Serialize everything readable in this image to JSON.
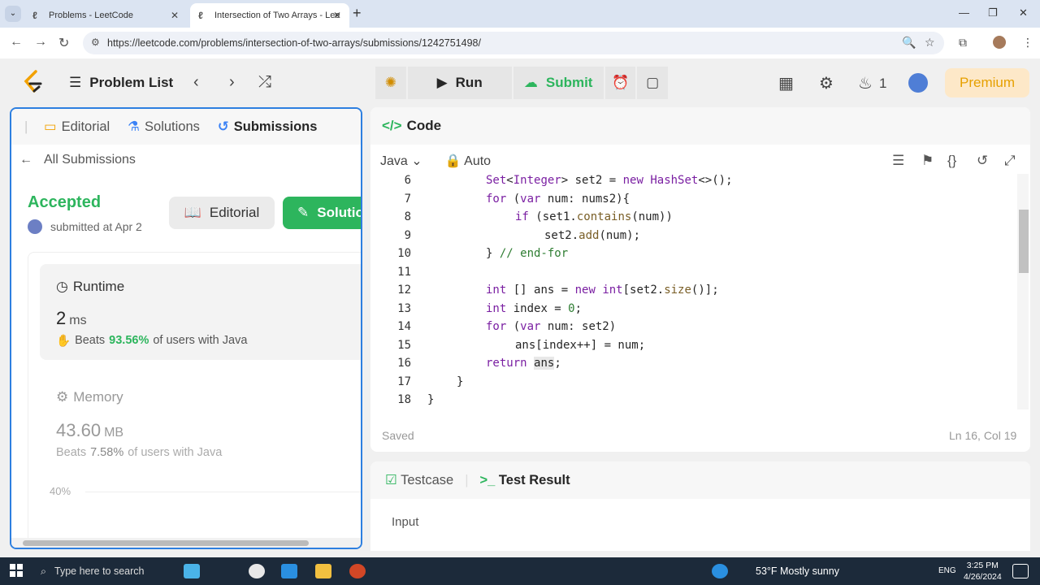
{
  "browser": {
    "tabs": [
      {
        "title": "Problems - LeetCode",
        "close": "✕"
      },
      {
        "title": "Intersection of Two Arrays - Lee",
        "close": "✕"
      }
    ],
    "url": "https://leetcode.com/problems/intersection-of-two-arrays/submissions/1242751498/"
  },
  "header": {
    "problem_list": "Problem List",
    "run": "Run",
    "submit": "Submit",
    "streak": "1",
    "premium": "Premium"
  },
  "left": {
    "tabs": [
      "Editorial",
      "Solutions",
      "Submissions"
    ],
    "all_submissions": "All Submissions",
    "status": "Accepted",
    "submitted": "submitted at Apr 2",
    "editorial_btn": "Editorial",
    "solution_btn": "Solution",
    "runtime": {
      "title": "Runtime",
      "value": "2",
      "unit": "ms",
      "beats_prefix": "Beats",
      "beats_pct": "93.56%",
      "beats_suffix": "of users with Java"
    },
    "memory": {
      "title": "Memory",
      "value": "43.60",
      "unit": "MB",
      "beats_prefix": "Beats",
      "beats_pct": "7.58%",
      "beats_suffix": "of users with Java"
    },
    "chart_tick": "40%"
  },
  "code": {
    "title": "Code",
    "language": "Java",
    "mode": "Auto",
    "saved": "Saved",
    "cursor": "Ln 16, Col 19",
    "lines": [
      {
        "n": "6"
      },
      {
        "n": "7"
      },
      {
        "n": "8"
      },
      {
        "n": "9"
      },
      {
        "n": "10"
      },
      {
        "n": "11"
      },
      {
        "n": "12"
      },
      {
        "n": "13"
      },
      {
        "n": "14"
      },
      {
        "n": "15"
      },
      {
        "n": "16"
      },
      {
        "n": "17"
      },
      {
        "n": "18"
      }
    ]
  },
  "test": {
    "testcase": "Testcase",
    "test_result": "Test Result",
    "input": "Input"
  },
  "taskbar": {
    "search": "Type here to search",
    "weather": "53°F  Mostly sunny",
    "lang": "ENG",
    "time": "3:25 PM",
    "date": "4/26/2024"
  }
}
